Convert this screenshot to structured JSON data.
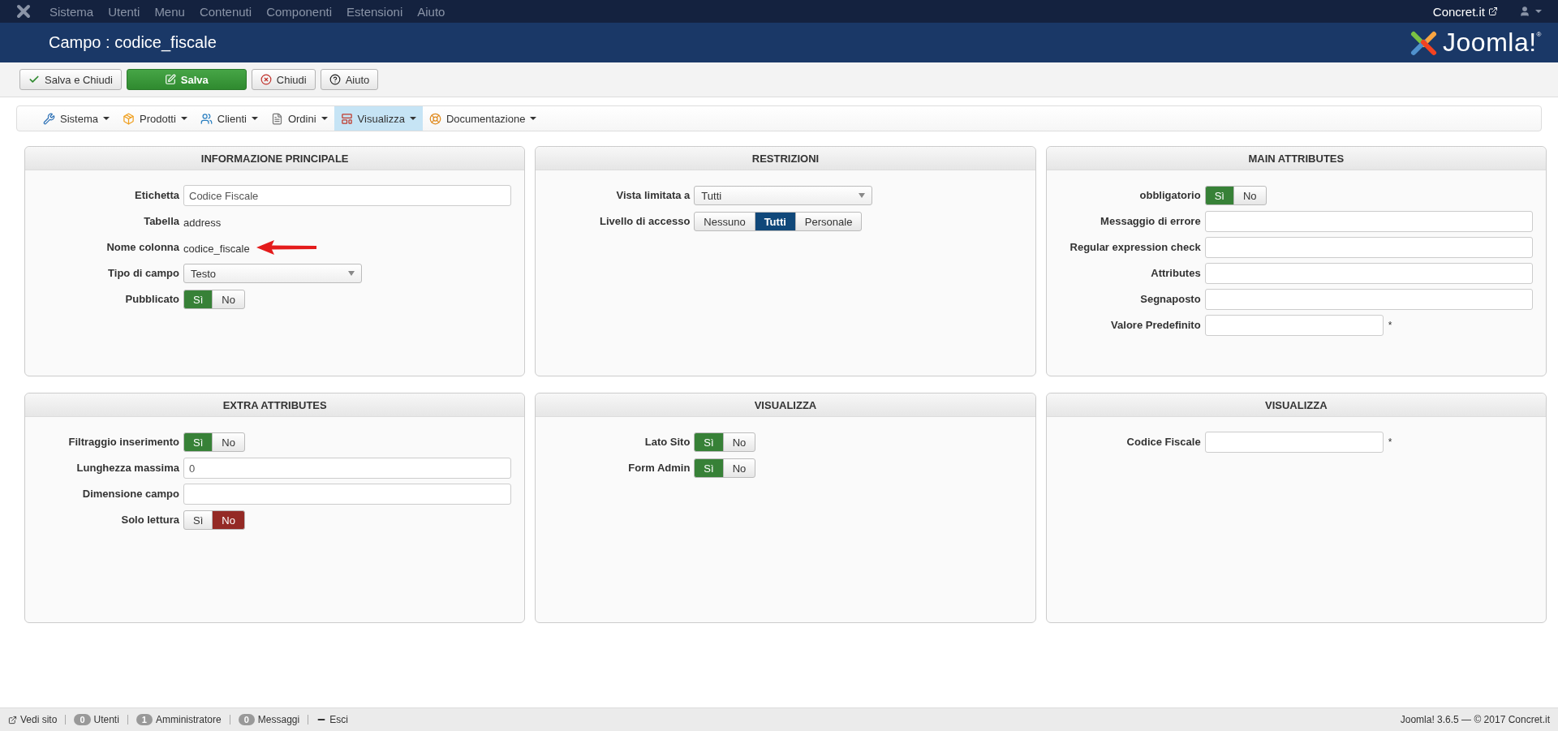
{
  "top_menu": {
    "items": [
      "Sistema",
      "Utenti",
      "Menu",
      "Contenuti",
      "Componenti",
      "Estensioni",
      "Aiuto"
    ],
    "site_link": "Concret.it"
  },
  "header": {
    "title": "Campo : codice_fiscale",
    "logo_text": "Joomla!",
    "logo_mark": "®"
  },
  "toolbar": [
    {
      "label": "Salva e Chiudi",
      "kind": "check"
    },
    {
      "label": "Salva",
      "kind": "primary"
    },
    {
      "label": "Chiudi",
      "kind": "close"
    },
    {
      "label": "Aiuto",
      "kind": "help"
    }
  ],
  "submenu": [
    {
      "label": "Sistema",
      "selected": false
    },
    {
      "label": "Prodotti",
      "selected": false
    },
    {
      "label": "Clienti",
      "selected": false
    },
    {
      "label": "Ordini",
      "selected": false
    },
    {
      "label": "Visualizza",
      "selected": true
    },
    {
      "label": "Documentazione",
      "selected": false
    }
  ],
  "panels": [
    {
      "title": "INFORMAZIONE PRINCIPALE",
      "rows": [
        {
          "kind": "input",
          "label": "Etichetta",
          "value": "Codice Fiscale",
          "short": false
        },
        {
          "kind": "text",
          "label": "Tabella",
          "value": "address",
          "marked": false
        },
        {
          "kind": "text",
          "label": "Nome colonna",
          "value": "codice_fiscale",
          "marked": true
        },
        {
          "kind": "select",
          "label": "Tipo di campo",
          "value": "Testo"
        },
        {
          "kind": "toggle",
          "label": "Pubblicato",
          "options": [
            {
              "label": "Sì",
              "selected": true,
              "kind": "yes"
            },
            {
              "label": "No",
              "selected": false,
              "kind": "no"
            }
          ]
        }
      ]
    },
    {
      "title": "RESTRIZIONI",
      "rows": [
        {
          "kind": "select",
          "label": "Vista limitata a",
          "value": "Tutti"
        },
        {
          "kind": "toggle",
          "label": "Livello di accesso",
          "options": [
            {
              "label": "Nessuno",
              "selected": false,
              "kind": "level"
            },
            {
              "label": "Tutti",
              "selected": true,
              "kind": "level"
            },
            {
              "label": "Personale",
              "selected": false,
              "kind": "level"
            }
          ]
        }
      ]
    },
    {
      "title": "MAIN ATTRIBUTES",
      "rows": [
        {
          "kind": "toggle",
          "label": "obbligatorio",
          "options": [
            {
              "label": "Sì",
              "selected": true,
              "kind": "yes"
            },
            {
              "label": "No",
              "selected": false,
              "kind": "no"
            }
          ]
        },
        {
          "kind": "input",
          "label": "Messaggio di errore",
          "short": false
        },
        {
          "kind": "input",
          "label": "Regular expression check",
          "short": false
        },
        {
          "kind": "input",
          "label": "Attributes",
          "short": false
        },
        {
          "kind": "input",
          "label": "Segnaposto",
          "short": false
        },
        {
          "kind": "input",
          "label": "Valore Predefinito",
          "short": true,
          "suffix": "*"
        }
      ]
    },
    {
      "title": "EXTRA ATTRIBUTES",
      "rows": [
        {
          "kind": "toggle",
          "label": "Filtraggio inserimento",
          "options": [
            {
              "label": "Sì",
              "selected": true,
              "kind": "yes"
            },
            {
              "label": "No",
              "selected": false,
              "kind": "no"
            }
          ]
        },
        {
          "kind": "input",
          "label": "Lunghezza massima",
          "value": "0",
          "short": false
        },
        {
          "kind": "input",
          "label": "Dimensione campo",
          "short": false
        },
        {
          "kind": "toggle",
          "label": "Solo lettura",
          "options": [
            {
              "label": "Sì",
              "selected": false,
              "kind": "yes"
            },
            {
              "label": "No",
              "selected": true,
              "kind": "no"
            }
          ]
        }
      ]
    },
    {
      "title": "VISUALIZZA",
      "rows": [
        {
          "kind": "toggle",
          "label": "Lato Sito",
          "options": [
            {
              "label": "Sì",
              "selected": true,
              "kind": "yes"
            },
            {
              "label": "No",
              "selected": false,
              "kind": "no"
            }
          ]
        },
        {
          "kind": "toggle",
          "label": "Form Admin",
          "options": [
            {
              "label": "Sì",
              "selected": true,
              "kind": "yes"
            },
            {
              "label": "No",
              "selected": false,
              "kind": "no"
            }
          ]
        }
      ]
    },
    {
      "title": "VISUALIZZA",
      "rows": [
        {
          "kind": "input",
          "label": "Codice Fiscale",
          "short": true,
          "suffix": "*"
        }
      ]
    }
  ],
  "status_bar": {
    "items": [
      {
        "kind": "link",
        "label": "Vedi sito"
      },
      {
        "kind": "count",
        "count": "0",
        "label": "Utenti"
      },
      {
        "kind": "count",
        "count": "1",
        "label": "Amministratore"
      },
      {
        "kind": "count",
        "count": "0",
        "label": "Messaggi"
      },
      {
        "kind": "logout",
        "label": "Esci"
      }
    ],
    "right": "Joomla! 3.6.5  —  © 2017 Concret.it"
  }
}
